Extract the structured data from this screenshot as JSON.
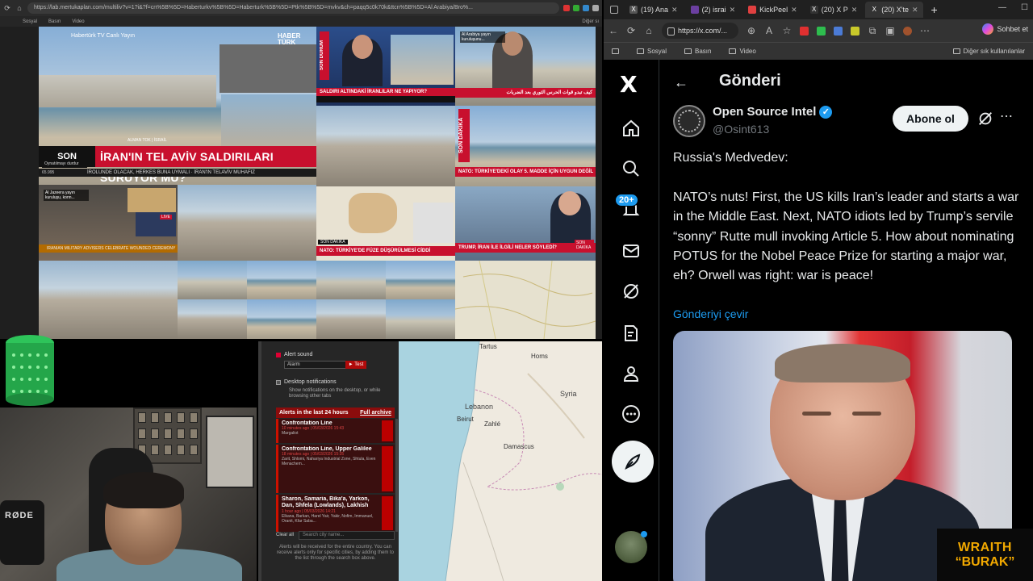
{
  "left_browser": {
    "url": "https://lab.mertukaplan.com/multiliv?v=1?i&?f=cn%5B%5D=Haberturkv%5B%5D=Haberturk%5B%5D=Ptk%5B%5D=mvkv&ch=paqq5c0k70k&ttcn%5B%5D=Al Arabiya/Bro%...",
    "bookmarks": [
      "Sosyal",
      "Basın",
      "Video"
    ],
    "bookmarks_right": "Diğer sı"
  },
  "tiles": {
    "main_brand": "HABER TÜRK",
    "main_live": "Habertürk TV Canlı Yayın",
    "main_son": "SON",
    "main_headline": "İRAN'IN TEL AVİV SALDIRILARI SÜRÜYOR MU?",
    "main_location": "ALMAN TOK | İSRAİL",
    "main_sub": "İROLUNDE OLACAK, HERKES BUNA UYMALI · İRAN'IN TELAVİV MUHAFIZ",
    "main_paused": "Oynatılmayı durdur",
    "main_counter": "65.995",
    "son_durum": "SON DURUM",
    "t2_head": "SALDIRI ALTINDAKİ İRANLILAR NE YAPIYOR?",
    "t3_tag": "Al Arabiya yayın kuruluşunu...",
    "t3_ticker": "كيف تبدو قوات الحرس الثوري بعد الضربات",
    "son_dakika": "SON DAKİKA",
    "t5_head": "NATO: TÜRKİYE'DEKİ OLAY 5. MADDE İÇİN UYGUN DEĞİL",
    "aj_tag": "Al Jazeera yayın kuruluşu, konn...",
    "aj_live": "LIVE",
    "aj_ticker": "IRANIAN MILITARY ADVISERS CELEBRATE WOUNDED CEREMONY",
    "t7_son": "SON DAKİKA",
    "t7_head": "NATO: TÜRKİYE'DE FÜZE DÜŞÜRÜLMESİ CİDDİ",
    "t8_head": "TRUMP, İRAN İLE İLGİLİ NELER SÖYLEDİ?",
    "t8_son": "SON DAKİKA"
  },
  "alerts": {
    "alert_sound_label": "Alert sound",
    "sound_select": "Alarm",
    "test_label": "► Test",
    "desktop_label": "Desktop notifications",
    "desktop_desc": "Show notifications on the desktop, or while browsing other tabs",
    "header": "Alerts in the last 24 hours",
    "archive": "Full archive",
    "items": [
      {
        "title": "Confrontation Line",
        "meta": "10 minutes ago | 05/03/2026 15:43",
        "place": "Margaliot"
      },
      {
        "title": "Confrontation Line, Upper Galilee",
        "meta": "18 minutes ago | 05/03/2026 15:35",
        "place": "Zarit, Shlomi, Nahariya Industrial Zone, Shtula, Even Menachem..."
      },
      {
        "title": "Sharon, Samaria, Bika'a, Yarkon, Dan, Shfela (Lowlands), Lakhish",
        "meta": "1 hour ago | 05/03/2026 14:21",
        "place": "Elkana, Barkan, Harel Yair, Yakir, Nofim, Immanuel, Oranit, Kfar Saba..."
      }
    ],
    "clear_all": "Clear all",
    "search_placeholder": "Search city name...",
    "note": "Alerts will be received for the entire country. You can receive alerts only for specific cities, by adding them to the list through the search box above."
  },
  "map": {
    "labels": [
      "Tartus",
      "Homs",
      "Lebanon",
      "Beirut",
      "Zahlé",
      "Damascus",
      "Syria"
    ]
  },
  "right_browser": {
    "tabs": [
      {
        "label": "(19) Ana",
        "color": "#555555"
      },
      {
        "label": "(2) israi",
        "color": "#6b3fa0"
      },
      {
        "label": "KickPeel",
        "color": "#e04040"
      },
      {
        "label": "(20) X P",
        "color": "#333333"
      },
      {
        "label": "(20) X'te",
        "color": "#333333"
      }
    ],
    "url": "https://x.com/...",
    "chat": "Sohbet et",
    "bookmarks": [
      "Sosyal",
      "Basın",
      "Video"
    ],
    "bookmarks_right": "Diğer sık kullanılanlar"
  },
  "x": {
    "logo": "X",
    "notif_badge": "20+",
    "page_title": "Gönderi",
    "author_name": "Open Source Intel",
    "author_handle": "@Osint613",
    "subscribe": "Abone ol",
    "tweet_text": "Russia's Medvedev:\n\nNATO’s nuts! First, the US kills Iran’s leader and starts a war in the Middle East. Next, NATO idiots led by Trump’s servile “sonny” Rutte mull invoking Article 5. How about nominating POTUS for the Nobel Peace Prize for starting a major war, eh? Orwell was right: war is peace!",
    "translate": "Gönderiyi çevir"
  },
  "webcam": {
    "mic_brand": "RØDE"
  },
  "overlay": {
    "line1": "WRAITH",
    "line2": "“BURAK”"
  }
}
